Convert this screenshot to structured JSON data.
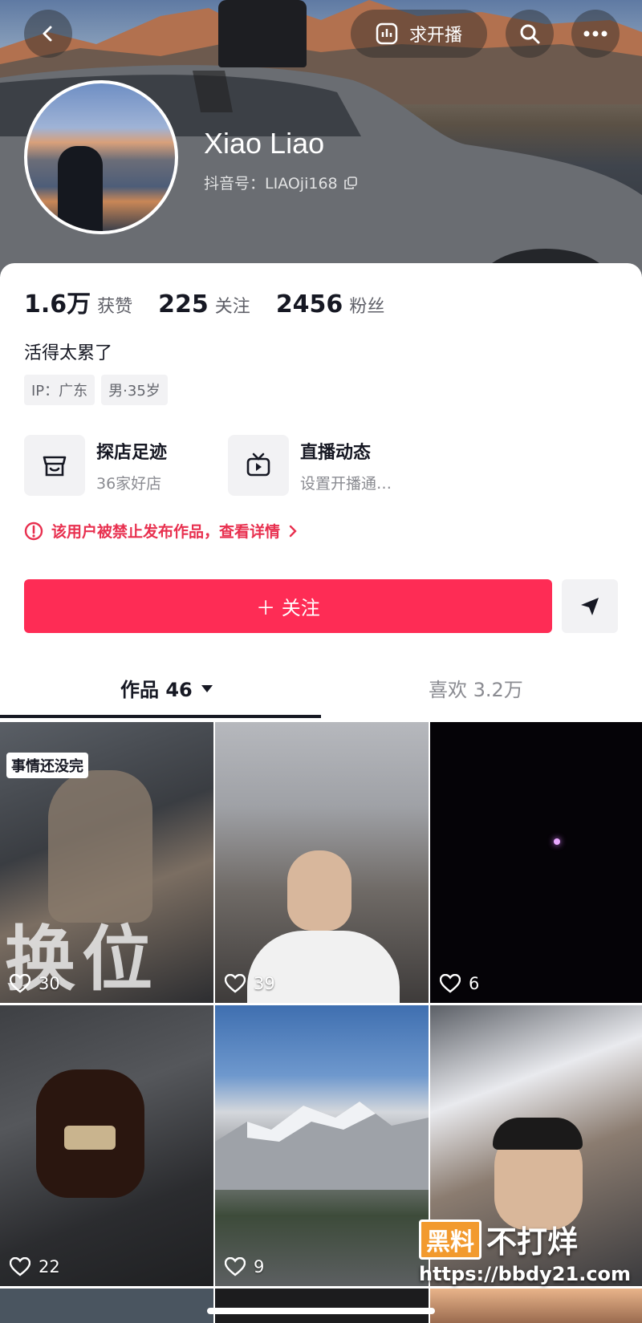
{
  "header": {
    "live_label": "求开播",
    "name": "Xiao Liao",
    "douyin_id": "抖音号：LIAOji168"
  },
  "stats": [
    {
      "value": "1.6万",
      "label": "获赞"
    },
    {
      "value": "225",
      "label": "关注"
    },
    {
      "value": "2456",
      "label": "粉丝"
    }
  ],
  "bio": "活得太累了",
  "tags": [
    "IP：广东",
    "男·35岁"
  ],
  "features": [
    {
      "title": "探店足迹",
      "subtitle": "36家好店",
      "icon": "shop-icon"
    },
    {
      "title": "直播动态",
      "subtitle": "设置开播通…",
      "icon": "tv-icon"
    }
  ],
  "warning": "该用户被禁止发布作品，查看详情",
  "follow_label": "＋ 关注",
  "tabs": {
    "works": "作品 46",
    "likes": "喜欢 3.2万"
  },
  "videos": [
    {
      "likes": "30",
      "badge": "事情还没完",
      "overlay": "换位"
    },
    {
      "likes": "39"
    },
    {
      "likes": "6"
    },
    {
      "likes": "22"
    },
    {
      "likes": "9"
    },
    {
      "likes": ""
    }
  ],
  "watermark": {
    "brand_box": "黑料",
    "brand_text": "不打烊",
    "url": "https://bbdy21.com"
  },
  "colors": {
    "accent": "#fe2c55",
    "warning": "#e8304f"
  }
}
